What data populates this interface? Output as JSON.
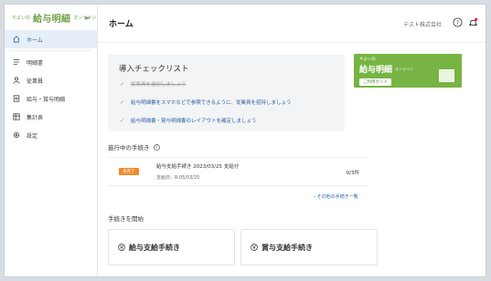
{
  "brand": {
    "prefix": "やよいの",
    "name": "給与明細",
    "suffix": "オンライン",
    "collapse": "⇤"
  },
  "sidebar": {
    "items": [
      {
        "label": "ホーム",
        "icon": "home-icon",
        "active": true
      },
      {
        "label": "明細書",
        "icon": "list-icon"
      },
      {
        "label": "従業員",
        "icon": "person-icon"
      },
      {
        "label": "給与・賞与明細",
        "icon": "document-icon"
      },
      {
        "label": "集計表",
        "icon": "table-icon"
      },
      {
        "label": "設定",
        "icon": "gear-icon"
      }
    ]
  },
  "header": {
    "title": "ホーム",
    "company": "テスト株式会社",
    "help_icon": "help-icon",
    "bell_icon": "bell-icon"
  },
  "checklist": {
    "title": "導入チェックリスト",
    "items": [
      {
        "text": "従業員を追加しましょう",
        "done": true
      },
      {
        "text": "給与明細書をスマホなどで参照できるように、従業員を招待しましょう",
        "done": false
      },
      {
        "text": "給与明細書・賞与明細書のレイアウトを確定しましょう",
        "done": false
      }
    ]
  },
  "banner": {
    "line1": "やよいの",
    "line2": "給与明細",
    "line3": "オンライン",
    "button": "ご利用ガイド"
  },
  "in_progress": {
    "label": "進行中の手続き",
    "badge": "未完了",
    "title": "給与支給手続き 2023/03/25 支給分",
    "sub": "支給日：R.05/03/25",
    "count": "0/3件",
    "see_all": "その他の手続き一覧"
  },
  "start": {
    "label": "手続きを開始",
    "salary": "給与支給手続き",
    "bonus": "賞与支給手続き"
  },
  "colors": {
    "accent": "#2b5fa8",
    "brand_green": "#77b443",
    "badge_orange": "#ef8a2e"
  }
}
